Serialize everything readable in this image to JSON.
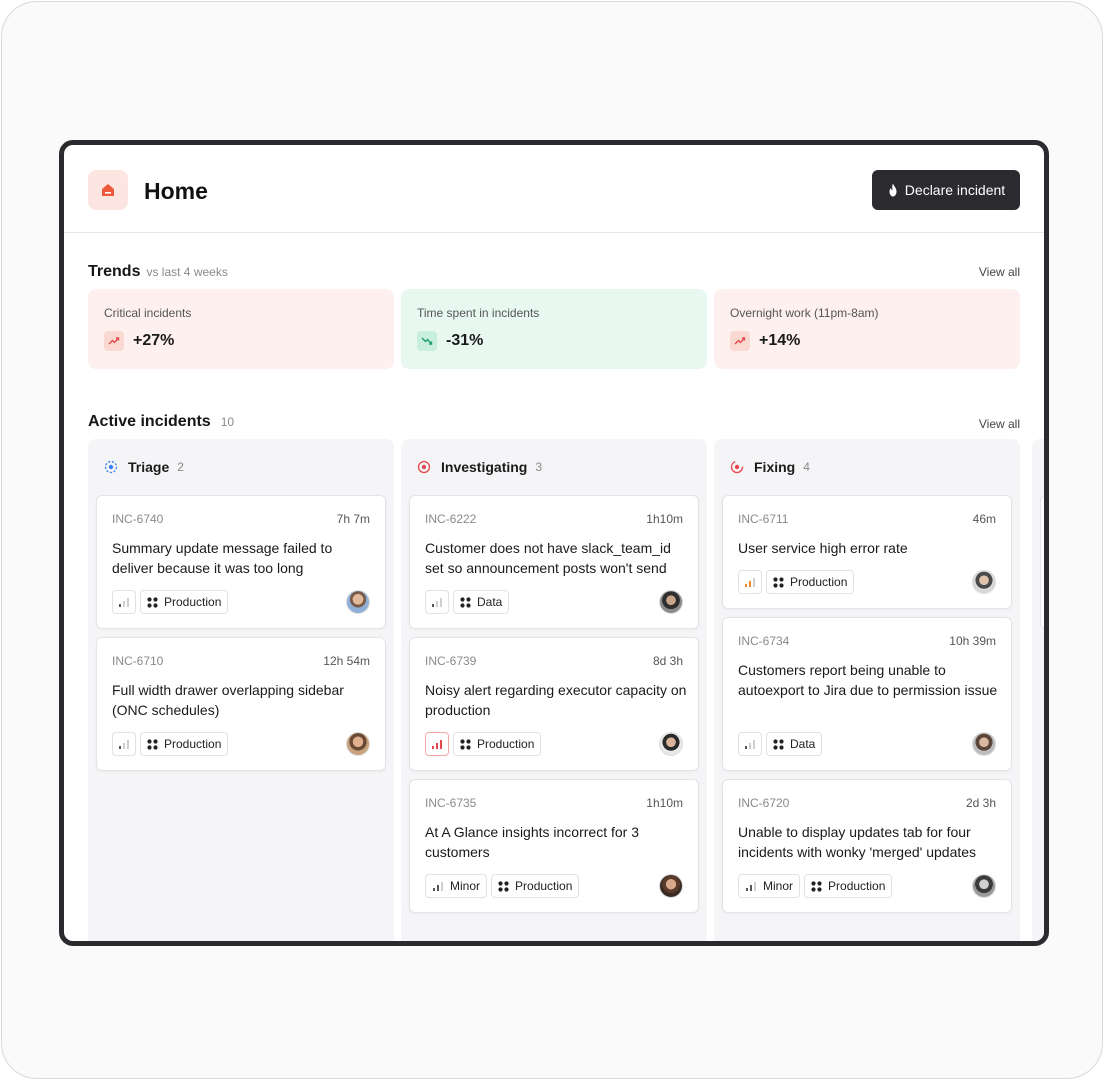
{
  "header": {
    "title": "Home",
    "declare_label": "Declare incident",
    "home_color": "#f05a3c"
  },
  "trends": {
    "title": "Trends",
    "subtitle": "vs last 4 weeks",
    "view_all": "View all",
    "cards": [
      {
        "label": "Critical incidents",
        "value": "+27%",
        "tone": "red",
        "icon": "trend-up-icon"
      },
      {
        "label": "Time spent in incidents",
        "value": "-31%",
        "tone": "green",
        "icon": "trend-down-icon"
      },
      {
        "label": "Overnight work (11pm-8am)",
        "value": "+14%",
        "tone": "red",
        "icon": "trend-up-icon"
      }
    ]
  },
  "active": {
    "title": "Active incidents",
    "count": "10",
    "view_all": "View all",
    "columns": [
      {
        "name": "Triage",
        "count": "2",
        "status_color": "#3b82f6",
        "cards": [
          {
            "id": "INC-6740",
            "time": "7h 7m",
            "title": "Summary update message failed to deliver because it was too long",
            "severity": "low",
            "severity_label": "",
            "env": "Production"
          },
          {
            "id": "INC-6710",
            "time": "12h 54m",
            "title": "Full width drawer overlapping sidebar (ONC schedules)",
            "severity": "low",
            "severity_label": "",
            "env": "Production"
          }
        ]
      },
      {
        "name": "Investigating",
        "count": "3",
        "status_color": "#e5484d",
        "cards": [
          {
            "id": "INC-6222",
            "time": "1h10m",
            "title": "Customer does not have slack_team_id set so announcement posts won't send",
            "severity": "low",
            "severity_label": "",
            "env": "Data"
          },
          {
            "id": "INC-6739",
            "time": "8d 3h",
            "title": "Noisy alert regarding executor capacity on production",
            "severity": "critical",
            "severity_label": "",
            "env": "Production"
          },
          {
            "id": "INC-6735",
            "time": "1h10m",
            "title": "At A Glance insights incorrect for 3 customers",
            "severity": "minor",
            "severity_label": "Minor",
            "env": "Production"
          }
        ]
      },
      {
        "name": "Fixing",
        "count": "4",
        "status_color": "#e5484d",
        "cards": [
          {
            "id": "INC-6711",
            "time": "46m",
            "title": "User service high error rate",
            "severity": "major",
            "severity_label": "",
            "env": "Production"
          },
          {
            "id": "INC-6734",
            "time": "10h 39m",
            "title": "Customers report being unable to autoexport to Jira due to permission issue",
            "severity": "low",
            "severity_label": "",
            "env": "Data"
          },
          {
            "id": "INC-6720",
            "time": "2d 3h",
            "title": "Unable to display updates tab for four incidents with wonky 'merged' updates",
            "severity": "minor",
            "severity_label": "Minor",
            "env": "Production"
          }
        ]
      }
    ]
  }
}
